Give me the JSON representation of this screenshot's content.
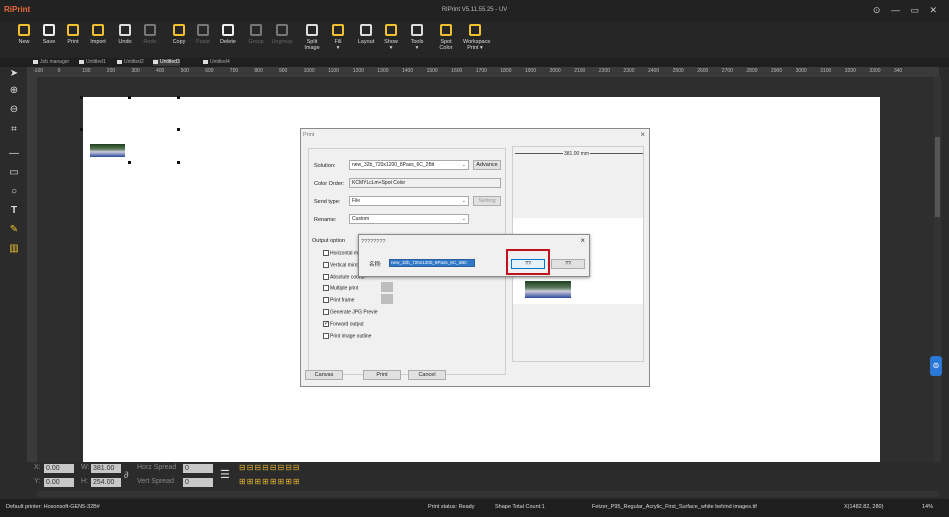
{
  "app": {
    "logo": "RiPrint",
    "title": "RIPrint V5.11.55.25 - UV",
    "window_controls": "⊙ — ▭ ✕"
  },
  "toolbar": [
    {
      "label": "New",
      "icon": "new-icon",
      "enabled": true
    },
    {
      "label": "Save",
      "icon": "save-icon",
      "enabled": true
    },
    {
      "label": "Print",
      "icon": "print-icon",
      "enabled": true
    },
    {
      "label": "Import",
      "icon": "import-icon",
      "enabled": true
    },
    {
      "label": "Undo",
      "icon": "undo-icon",
      "enabled": true
    },
    {
      "label": "Redo",
      "icon": "redo-icon",
      "enabled": false
    },
    {
      "label": "Copy",
      "icon": "copy-icon",
      "enabled": true
    },
    {
      "label": "Paste",
      "icon": "paste-icon",
      "enabled": false
    },
    {
      "label": "Delete",
      "icon": "delete-icon",
      "enabled": true
    },
    {
      "label": "Group",
      "icon": "group-icon",
      "enabled": false
    },
    {
      "label": "Ungroup",
      "icon": "ungroup-icon",
      "enabled": false
    },
    {
      "label": "Split\nImage",
      "icon": "split-image-icon",
      "enabled": true
    },
    {
      "label": "Fill\n▾",
      "icon": "fill-icon",
      "enabled": true
    },
    {
      "label": "Layout",
      "icon": "layout-icon",
      "enabled": true
    },
    {
      "label": "Show\n▾",
      "icon": "show-icon",
      "enabled": true
    },
    {
      "label": "Tools\n▾",
      "icon": "tools-icon",
      "enabled": true
    },
    {
      "label": "Spot\nColor",
      "icon": "spot-color-icon",
      "enabled": true
    },
    {
      "label": "Workspace\nPrint ▾",
      "icon": "workspace-print-icon",
      "enabled": true
    }
  ],
  "tabs": [
    {
      "label": "Job manager",
      "active": false
    },
    {
      "label": "Untitled1",
      "active": false
    },
    {
      "label": "Untitled2",
      "active": false
    },
    {
      "label": "Untitled3",
      "active": true
    },
    {
      "label": "Untitled4",
      "active": false
    }
  ],
  "ruler_ticks": [
    "-100",
    "0",
    "100",
    "200",
    "300",
    "400",
    "500",
    "600",
    "700",
    "800",
    "900",
    "1000",
    "1100",
    "1200",
    "1300",
    "1400",
    "1500",
    "1600",
    "1700",
    "1800",
    "1900",
    "2000",
    "2100",
    "2200",
    "2300",
    "2400",
    "2500",
    "2600",
    "2700",
    "2800",
    "2900",
    "3000",
    "3100",
    "3200",
    "3300",
    "340"
  ],
  "bottom": {
    "x_label": "X:",
    "x_value": "0.00",
    "y_label": "Y:",
    "y_value": "0.00",
    "w_label": "W:",
    "w_value": "381.00",
    "h_label": "H:",
    "h_value": "254.00",
    "horz_label": "Horz Spread",
    "horz_value": "0",
    "vert_label": "Vert Spread",
    "vert_value": "0"
  },
  "status": {
    "printer": "Default printer: Hosonsoft-GEN5-32B#",
    "print_status": "Print status: Ready",
    "shape_count": "Shape Total Count:1",
    "file": "Fetzer_P95_Regular_Acrylic_First_Surface_white behind images.tif",
    "coords": "X(1482.82, 280)",
    "zoom": "14%"
  },
  "print_dialog": {
    "title": "Print",
    "solution_label": "Solution:",
    "solution_value": "new_32b_720x1200_8Pass_6C_2Bit",
    "advance_button": "Advance",
    "color_order_label": "Color Order:",
    "color_order_value": "KCMYLcLm+Spot Color",
    "send_type_label": "Send type:",
    "send_type_value": "File",
    "setting_button": "Setting",
    "rename_label": "Rename:",
    "rename_value": "Custom",
    "output_option_label": "Output option",
    "options": [
      {
        "label": "Horizontal mirror",
        "checked": false
      },
      {
        "label": "Vertical mirror",
        "checked": false
      },
      {
        "label": "Absolute coordi",
        "checked": false
      },
      {
        "label": "Multiple print",
        "checked": false
      },
      {
        "label": "Print frame",
        "checked": false
      },
      {
        "label": "Generate JPG Previe",
        "checked": false
      },
      {
        "label": "Forward output",
        "checked": true
      },
      {
        "label": "Print image outline",
        "checked": false
      }
    ],
    "preview_dimension": "381.00 mm",
    "canvas_button": "Canvas",
    "print_button": "Print",
    "cancel_button": "Cancel"
  },
  "name_dialog": {
    "title": "????????",
    "name_label": "名称:",
    "name_value": "new_32b_720x1200_8Pass_6C_2Bit",
    "ok_button": "??",
    "cancel_button": "??"
  },
  "colors": {
    "highlight_box": "#c0121c",
    "selection": "#3178c6"
  }
}
